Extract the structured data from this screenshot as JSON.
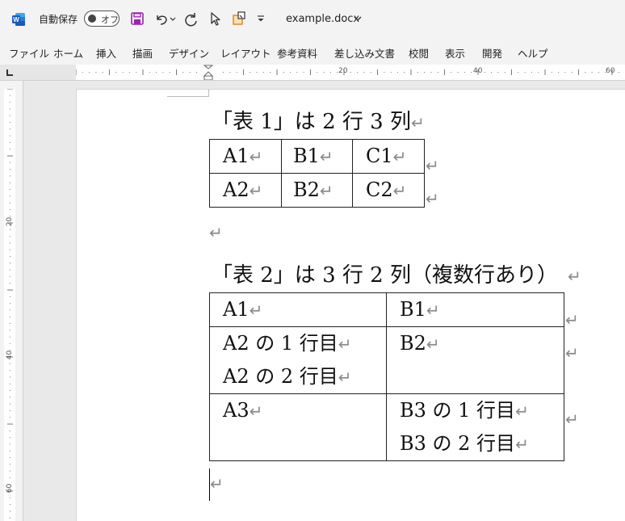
{
  "titlebar": {
    "app_icon": "word-icon",
    "autosave_label": "自動保存",
    "autosave_state": "オフ",
    "document_name": "example.docx"
  },
  "menu": [
    "ファイル",
    "ホーム",
    "挿入",
    "描画",
    "デザイン",
    "レイアウト",
    "参考資料",
    "差し込み文書",
    "校閲",
    "表示",
    "開発",
    "ヘルプ"
  ],
  "ruler": {
    "horizontal_labels": [
      "20",
      "40",
      "60"
    ],
    "vertical_labels": [
      "20",
      "40",
      "60"
    ]
  },
  "document": {
    "paragraph_mark": "↵",
    "heading1": "「表 1」は 2 行 3 列",
    "table1": [
      [
        "A1",
        "B1",
        "C1"
      ],
      [
        "A2",
        "B2",
        "C2"
      ]
    ],
    "heading2": "「表 2」は 3 行 2 列（複数行あり）",
    "table2": [
      [
        [
          "A1"
        ],
        [
          "B1"
        ]
      ],
      [
        [
          "A2 の 1 行目",
          "A2 の 2 行目"
        ],
        [
          "B2"
        ]
      ],
      [
        [
          "A3"
        ],
        [
          "B3 の 1 行目",
          "B3 の 2 行目"
        ]
      ]
    ]
  },
  "colors": {
    "accent_save": "#a01fb5",
    "word_blue": "#185abd",
    "page": "#ffffff",
    "canvas": "#e9e9e9"
  }
}
